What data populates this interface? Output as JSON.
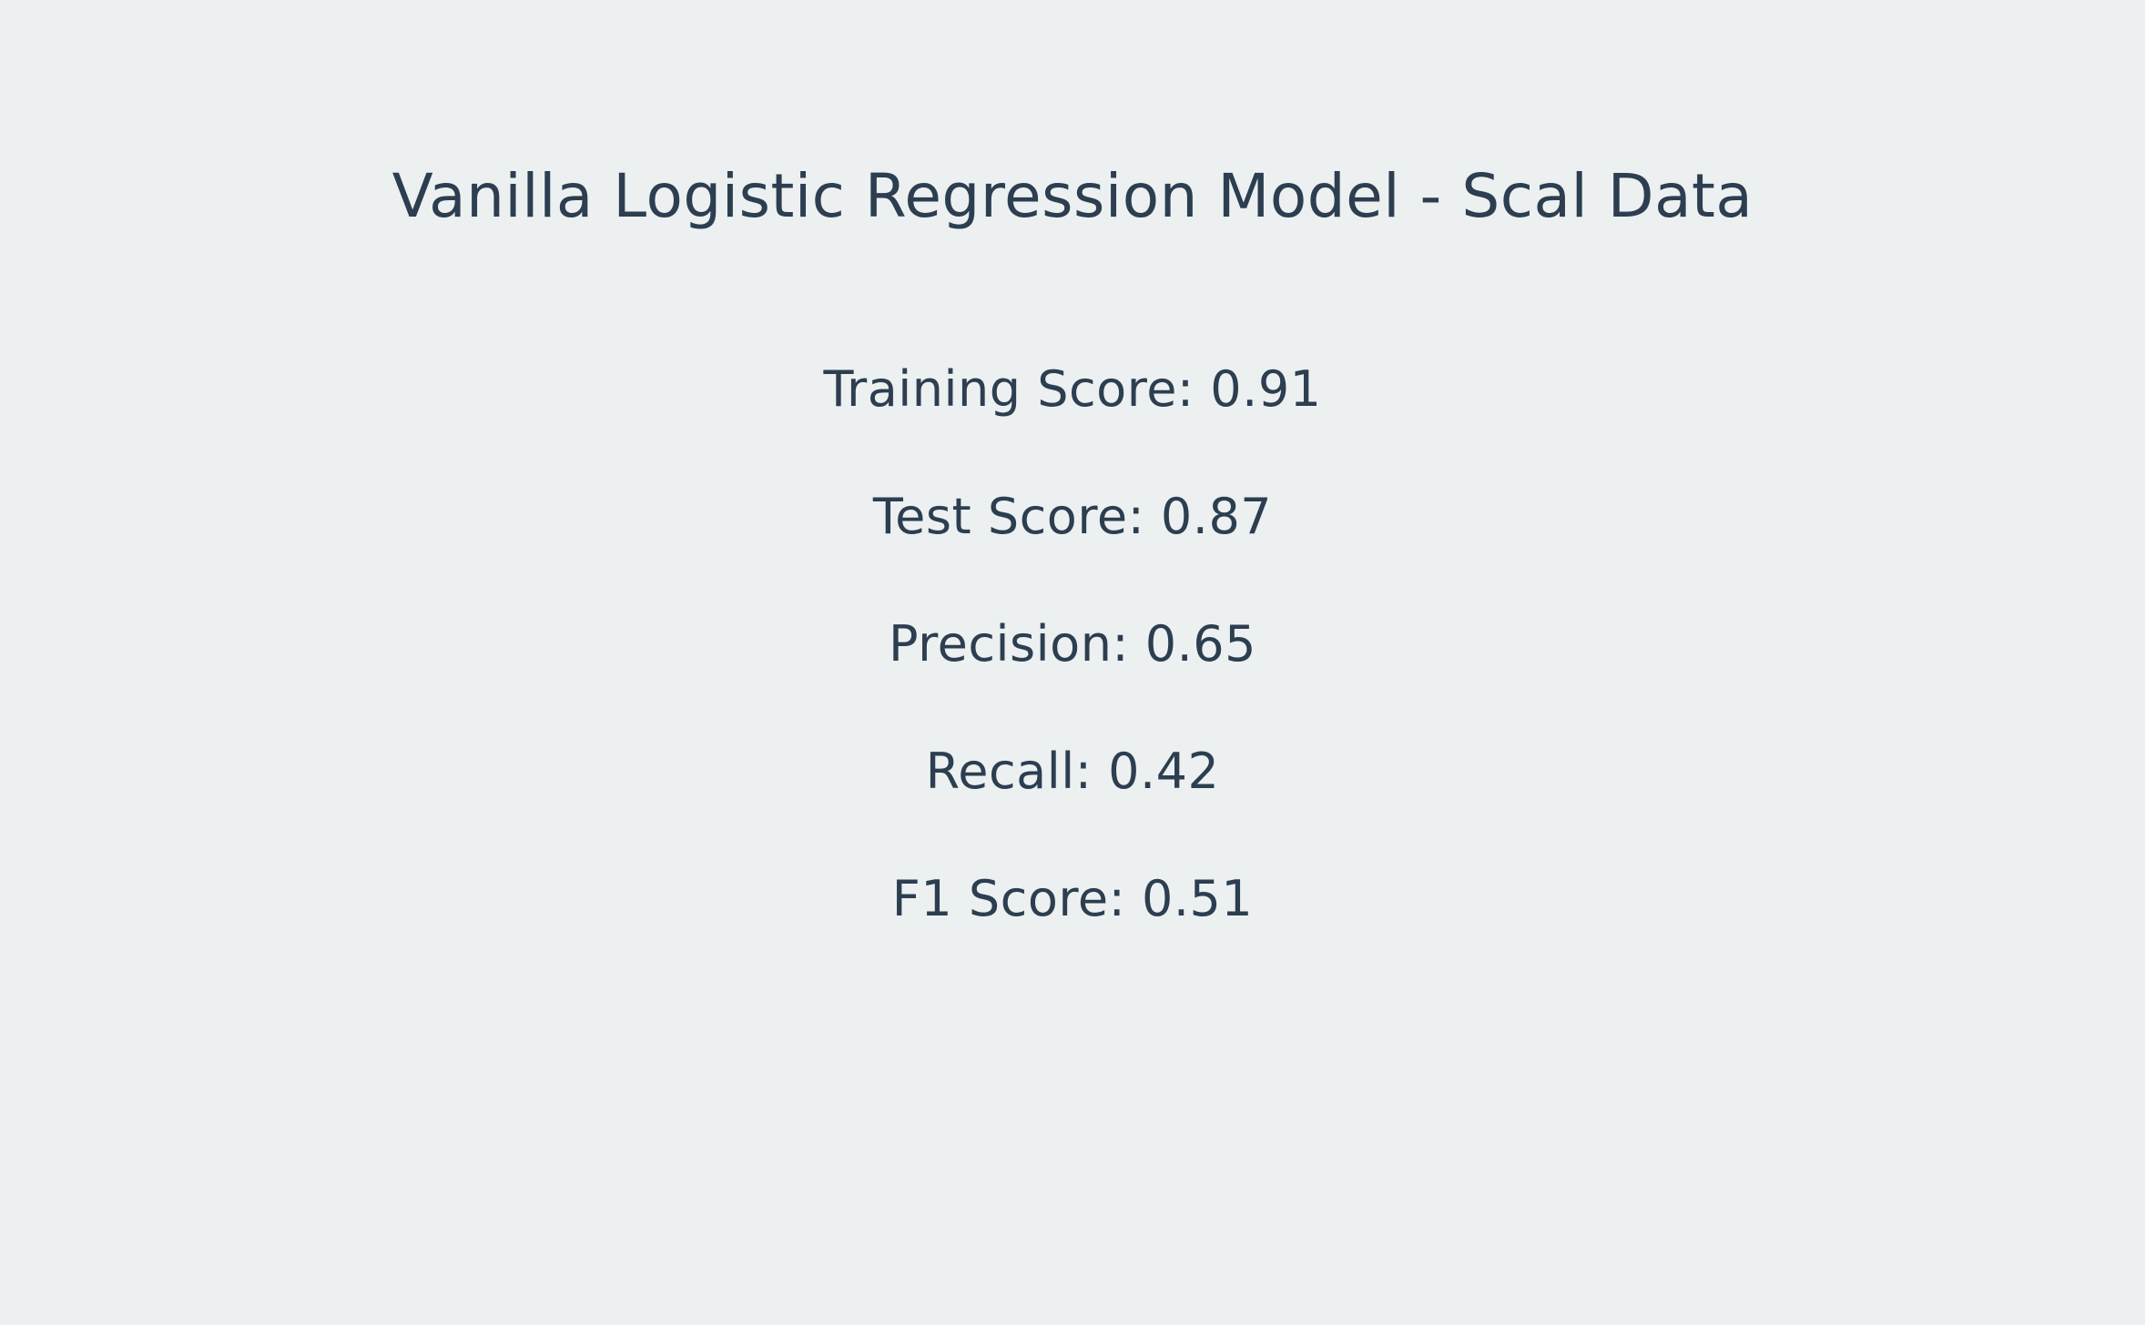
{
  "title": "Vanilla Logistic Regression Model - Scal Data",
  "metrics": [
    "Training Score: 0.91",
    "Test Score: 0.87",
    "Precision: 0.65",
    "Recall: 0.42",
    "F1 Score: 0.51"
  ],
  "colors": {
    "background": "#ecf0f1",
    "text": "#2c3e50"
  }
}
